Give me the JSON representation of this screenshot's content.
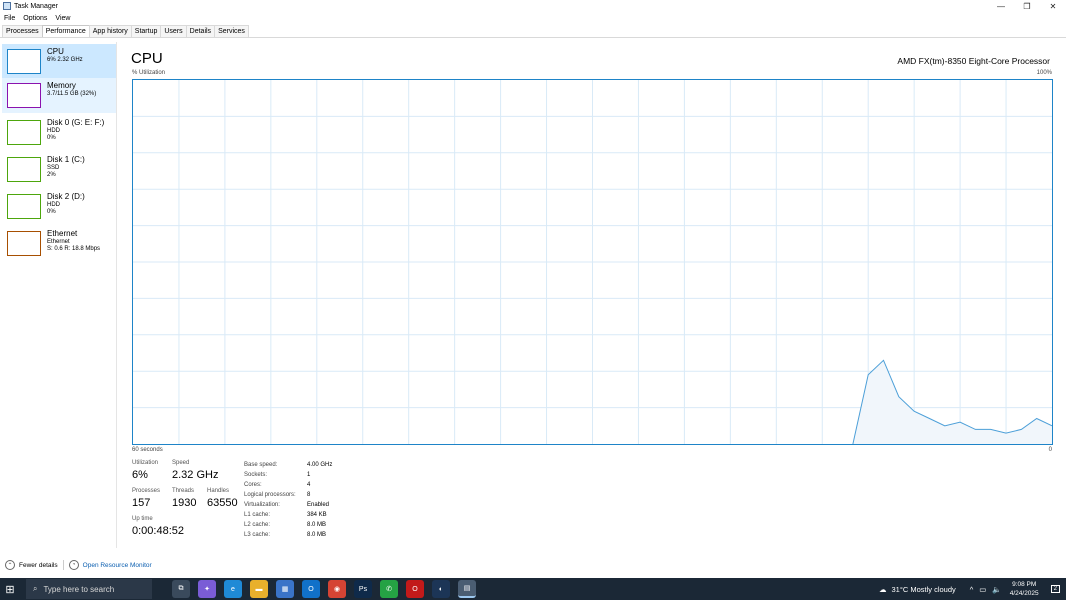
{
  "window": {
    "title": "Task Manager",
    "controls": [
      "—",
      "❐",
      "✕"
    ]
  },
  "menu": [
    "File",
    "Options",
    "View"
  ],
  "tabs": [
    "Processes",
    "Performance",
    "App history",
    "Startup",
    "Users",
    "Details",
    "Services"
  ],
  "sidebar": [
    {
      "name": "CPU",
      "sub1": "6% 2.32 GHz",
      "sub2": "",
      "sub3": "",
      "color": "#1e84c8"
    },
    {
      "name": "Memory",
      "sub1": "3.7/11.5 GB (32%)",
      "sub2": "",
      "sub3": "",
      "color": "#8b12ae"
    },
    {
      "name": "Disk 0 (G: E: F:)",
      "sub1": "HDD",
      "sub2": "0%",
      "sub3": "",
      "color": "#4da60c"
    },
    {
      "name": "Disk 1 (C:)",
      "sub1": "SSD",
      "sub2": "2%",
      "sub3": "",
      "color": "#4da60c"
    },
    {
      "name": "Disk 2 (D:)",
      "sub1": "HDD",
      "sub2": "0%",
      "sub3": "",
      "color": "#4da60c"
    },
    {
      "name": "Ethernet",
      "sub1": "Ethernet",
      "sub2": "S: 0.6 R: 18.8 Mbps",
      "sub3": "",
      "color": "#a74f01"
    }
  ],
  "main": {
    "title": "CPU",
    "processor": "AMD FX(tm)-8350 Eight-Core Processor",
    "util_label": "% Utilization",
    "max_label": "100%",
    "seconds_label": "60 seconds",
    "zero_label": "0"
  },
  "chart_data": {
    "type": "area",
    "series": [
      {
        "values": [
          0,
          0,
          0,
          0,
          0,
          0,
          0,
          0,
          0,
          0,
          0,
          0,
          0,
          0,
          0,
          0,
          0,
          0,
          0,
          0,
          0,
          0,
          0,
          0,
          0,
          0,
          0,
          0,
          0,
          0,
          0,
          0,
          0,
          0,
          0,
          0,
          0,
          0,
          0,
          0,
          0,
          0,
          0,
          0,
          0,
          0,
          0,
          0,
          19,
          23,
          13,
          9,
          7,
          5,
          6,
          4,
          4,
          3,
          4,
          7,
          5
        ]
      }
    ],
    "ylim": [
      0,
      100
    ],
    "grid": true
  },
  "stats": {
    "utilization": {
      "label": "Utilization",
      "value": "6%"
    },
    "speed": {
      "label": "Speed",
      "value": "2.32 GHz"
    },
    "processes": {
      "label": "Processes",
      "value": "157"
    },
    "threads": {
      "label": "Threads",
      "value": "1930"
    },
    "handles": {
      "label": "Handles",
      "value": "63550"
    },
    "uptime": {
      "label": "Up time",
      "value": "0:00:48:52"
    }
  },
  "details": [
    {
      "label": "Base speed:",
      "value": "4.00 GHz"
    },
    {
      "label": "Sockets:",
      "value": "1"
    },
    {
      "label": "Cores:",
      "value": "4"
    },
    {
      "label": "Logical processors:",
      "value": "8"
    },
    {
      "label": "Virtualization:",
      "value": "Enabled"
    },
    {
      "label": "L1 cache:",
      "value": "384 KB"
    },
    {
      "label": "L2 cache:",
      "value": "8.0 MB"
    },
    {
      "label": "L3 cache:",
      "value": "8.0 MB"
    }
  ],
  "footer": {
    "fewer_details": "Fewer details",
    "resource_monitor": "Open Resource Monitor"
  },
  "taskbar": {
    "search_placeholder": "Type here to search",
    "weather": "31°C  Mostly cloudy",
    "time": "9:08 PM",
    "date": "4/24/2025",
    "notification_count": "2",
    "whatsapp_badge": "4",
    "apps": [
      {
        "name": "task-view-icon",
        "color": "#3a4a5c",
        "glyph": "⧉"
      },
      {
        "name": "copilot-icon",
        "color": "#7a5cd6",
        "glyph": "✦"
      },
      {
        "name": "edge-icon",
        "color": "#1f8ad6",
        "glyph": "e"
      },
      {
        "name": "file-explorer-icon",
        "color": "#e8b02c",
        "glyph": "▬"
      },
      {
        "name": "store-icon",
        "color": "#3a74c8",
        "glyph": "▦"
      },
      {
        "name": "outlook-icon",
        "color": "#1171c9",
        "glyph": "O"
      },
      {
        "name": "chrome-icon",
        "color": "#d54434",
        "glyph": "◉"
      },
      {
        "name": "photoshop-icon",
        "color": "#0f2a4a",
        "glyph": "Ps"
      },
      {
        "name": "whatsapp-icon",
        "color": "#25a244",
        "glyph": "✆"
      },
      {
        "name": "opera-icon",
        "color": "#c21a1a",
        "glyph": "O"
      },
      {
        "name": "steam-icon",
        "color": "#1c3556",
        "glyph": "◐"
      },
      {
        "name": "task-manager-icon",
        "color": "#4a5d72",
        "glyph": "▤"
      }
    ]
  }
}
